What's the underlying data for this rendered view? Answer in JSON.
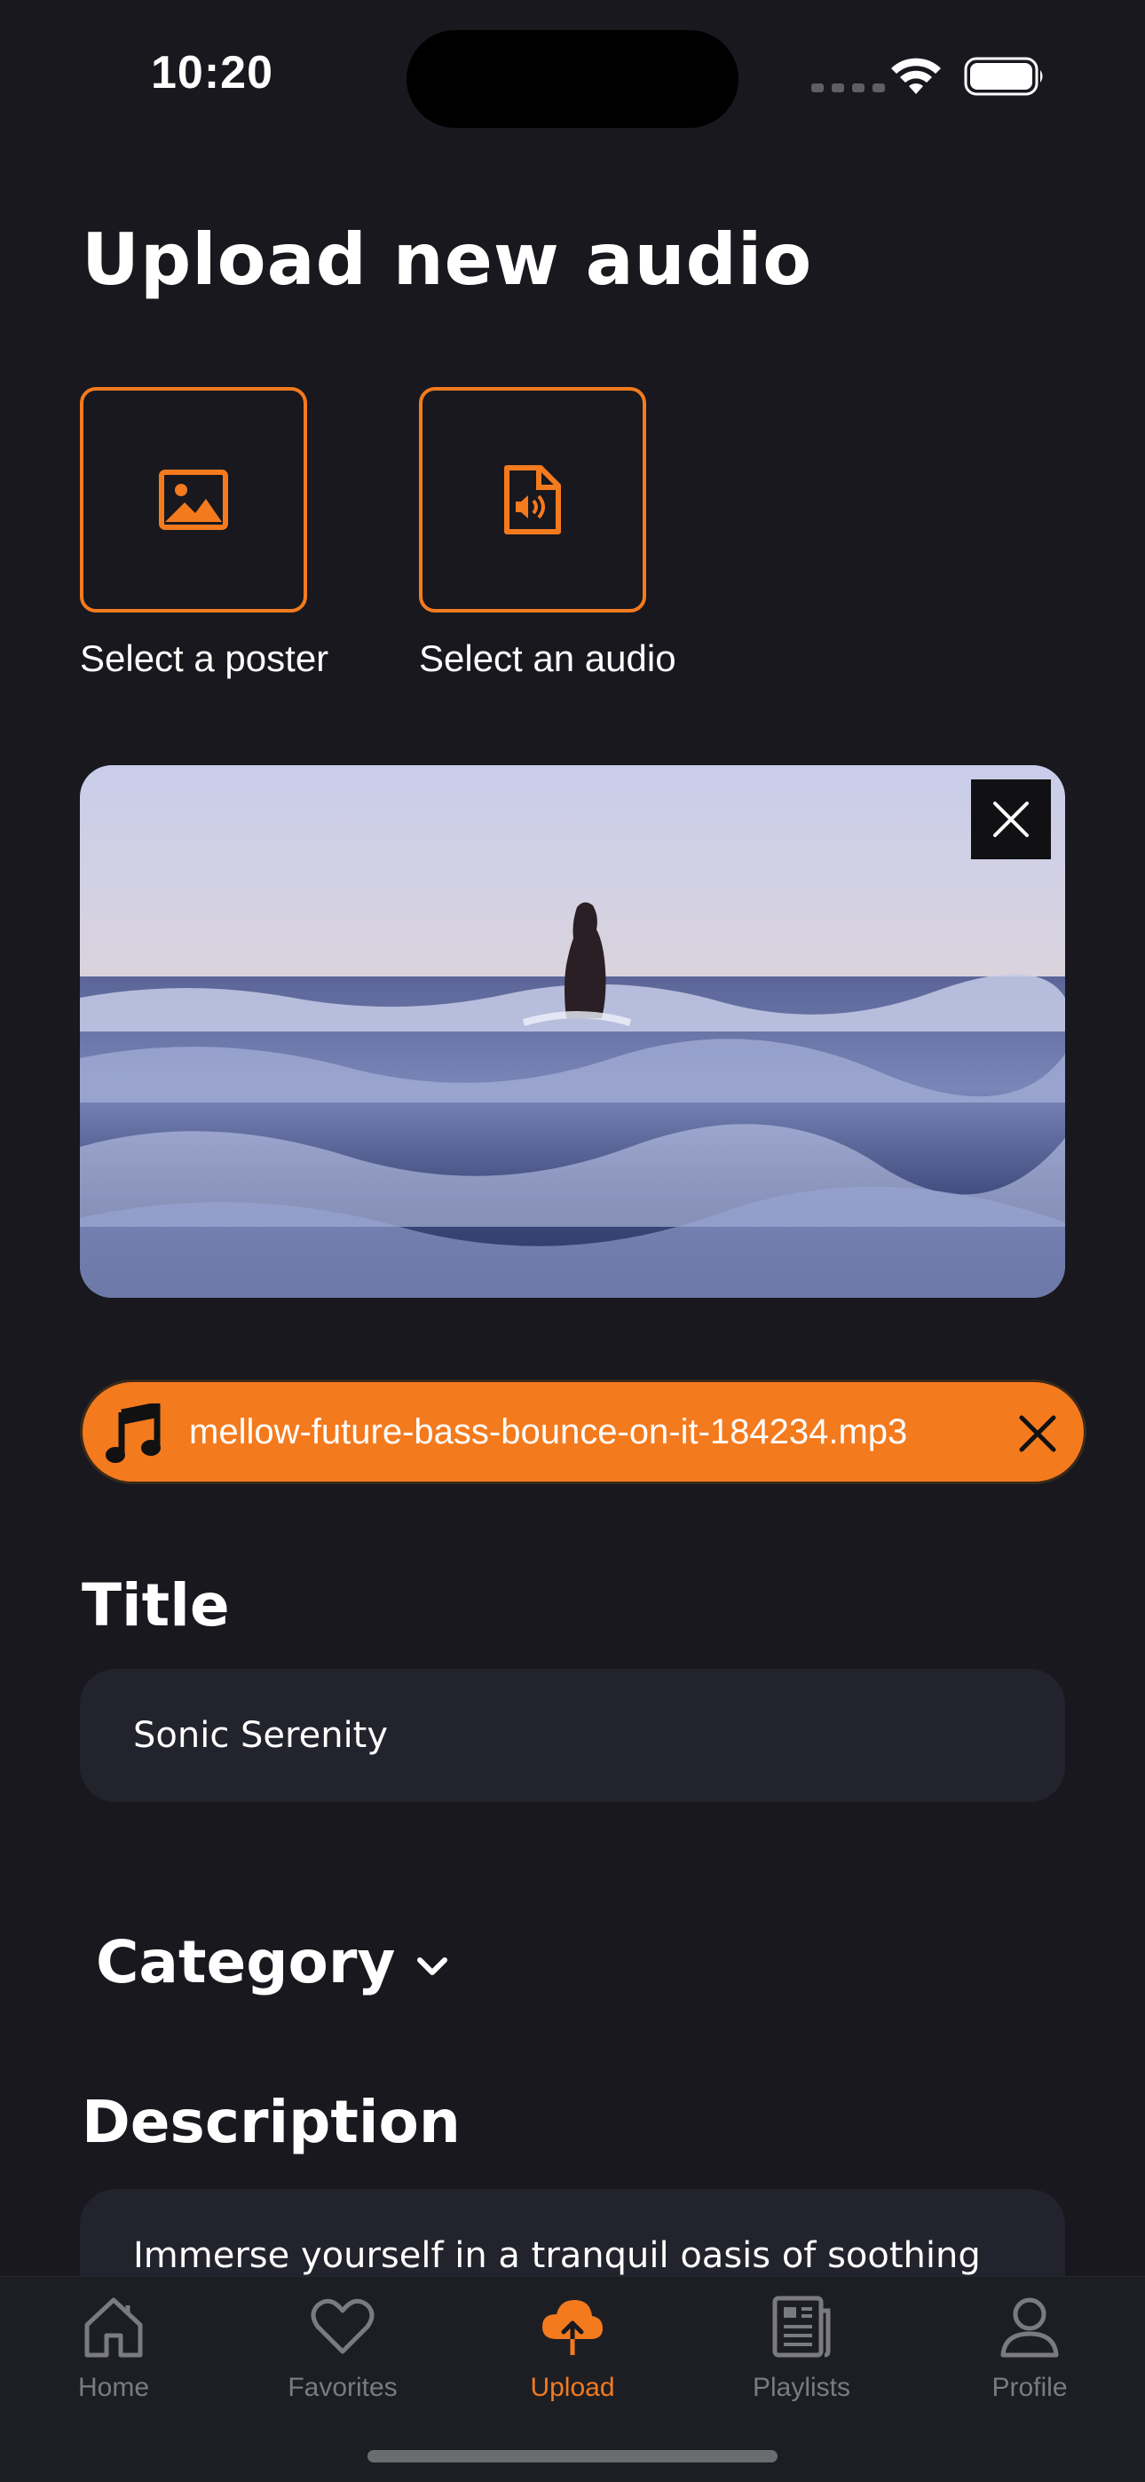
{
  "status": {
    "time": "10:20"
  },
  "page": {
    "title": "Upload new audio"
  },
  "picker": {
    "poster_label": "Select a poster",
    "audio_label": "Select an audio"
  },
  "audio_file": {
    "name": "mellow-future-bass-bounce-on-it-184234.mp3"
  },
  "form": {
    "title_label": "Title",
    "title_value": "Sonic Serenity",
    "category_label": "Category",
    "description_label": "Description",
    "description_value": "Immerse yourself in a tranquil oasis of soothing"
  },
  "tabs": [
    {
      "label": "Home",
      "icon": "home-icon",
      "active": false
    },
    {
      "label": "Favorites",
      "icon": "heart-icon",
      "active": false
    },
    {
      "label": "Upload",
      "icon": "cloud-upload-icon",
      "active": true
    },
    {
      "label": "Playlists",
      "icon": "playlists-icon",
      "active": false
    },
    {
      "label": "Profile",
      "icon": "profile-icon",
      "active": false
    }
  ],
  "colors": {
    "accent": "#f47a1e",
    "background": "#18181e",
    "field": "#22232c"
  }
}
